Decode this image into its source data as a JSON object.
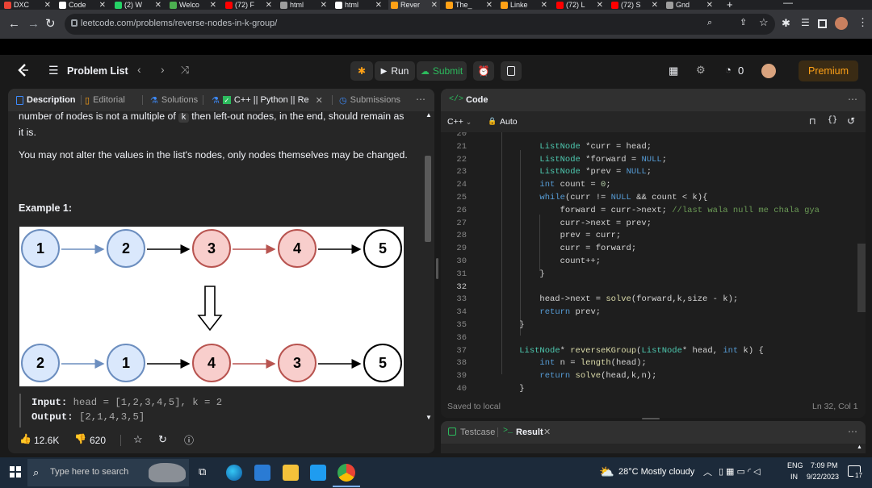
{
  "browser": {
    "tabs": [
      {
        "label": "DXC",
        "color": "#ea4335"
      },
      {
        "label": "Code",
        "color": "#ffffff"
      },
      {
        "label": "(2) W",
        "color": "#25d366"
      },
      {
        "label": "Welco",
        "color": "#4caf50"
      },
      {
        "label": "(72) F",
        "color": "#ff0000"
      },
      {
        "label": "html",
        "color": "#9e9e9e"
      },
      {
        "label": "html",
        "color": "#ffffff"
      },
      {
        "label": "Rever",
        "color": "#ffa116"
      },
      {
        "label": "The_",
        "color": "#ffa116"
      },
      {
        "label": "Linke",
        "color": "#ffa116"
      },
      {
        "label": "(72) L",
        "color": "#ff0000"
      },
      {
        "label": "(72) S",
        "color": "#ff0000"
      },
      {
        "label": "Gnd",
        "color": "#9e9e9e"
      }
    ],
    "new_tab": "+",
    "url": "leetcode.com/problems/reverse-nodes-in-k-group/"
  },
  "header": {
    "problem_list": "Problem List",
    "run": "Run",
    "submit": "Submit",
    "streak": "0",
    "premium": "Premium"
  },
  "left": {
    "tabs": {
      "description": "Description",
      "editorial": "Editorial",
      "solutions": "Solutions",
      "custom": "C++ || Python || Re",
      "submissions": "Submissions"
    },
    "para1_pre": "number of nodes is not a multiple of",
    "para1_code": "k",
    "para1_post": "then left-out nodes, in the end, should remain as",
    "para1_end": "it is.",
    "para2": "You may not alter the values in the list's nodes, only nodes themselves may be changed.",
    "example_title": "Example 1:",
    "diagram": {
      "top": [
        "1",
        "2",
        "3",
        "4",
        "5"
      ],
      "bottom": [
        "2",
        "1",
        "4",
        "3",
        "5"
      ]
    },
    "input_label": "Input:",
    "input_value": "head = [1,2,3,4,5], k = 2",
    "output_label": "Output:",
    "output_value": "[2,1,4,3,5]",
    "likes": "12.6K",
    "dislikes": "620"
  },
  "right": {
    "code_tab": "Code",
    "language": "C++",
    "auto": "Auto",
    "saved": "Saved to local",
    "cursor": "Ln 32, Col 1",
    "testcase": "Testcase",
    "result": "Result"
  },
  "code_lines": [
    {
      "n": "20",
      "t": ""
    },
    {
      "n": "21",
      "t": "        ListNode *curr = head;"
    },
    {
      "n": "22",
      "t": "        ListNode *forward = NULL;"
    },
    {
      "n": "23",
      "t": "        ListNode *prev = NULL;"
    },
    {
      "n": "24",
      "t": "        int count = 0;"
    },
    {
      "n": "25",
      "t": "        while(curr != NULL && count < k){"
    },
    {
      "n": "26",
      "t": "            forward = curr->next; //last wala null me chala gya"
    },
    {
      "n": "27",
      "t": "            curr->next = prev;"
    },
    {
      "n": "28",
      "t": "            prev = curr;"
    },
    {
      "n": "29",
      "t": "            curr = forward;"
    },
    {
      "n": "30",
      "t": "            count++;"
    },
    {
      "n": "31",
      "t": "        }"
    },
    {
      "n": "32",
      "t": ""
    },
    {
      "n": "33",
      "t": "        head->next = solve(forward,k,size - k);"
    },
    {
      "n": "34",
      "t": "        return prev;"
    },
    {
      "n": "35",
      "t": "    }"
    },
    {
      "n": "36",
      "t": ""
    },
    {
      "n": "37",
      "t": "    ListNode* reverseKGroup(ListNode* head, int k) {"
    },
    {
      "n": "38",
      "t": "        int n = length(head);"
    },
    {
      "n": "39",
      "t": "        return solve(head,k,n);"
    },
    {
      "n": "40",
      "t": "    }"
    }
  ],
  "taskbar": {
    "search_placeholder": "Type here to search",
    "weather": "28°C  Mostly cloudy",
    "lang1": "ENG",
    "lang2": "IN",
    "time": "7:09 PM",
    "date": "9/22/2023",
    "notif": "17"
  }
}
